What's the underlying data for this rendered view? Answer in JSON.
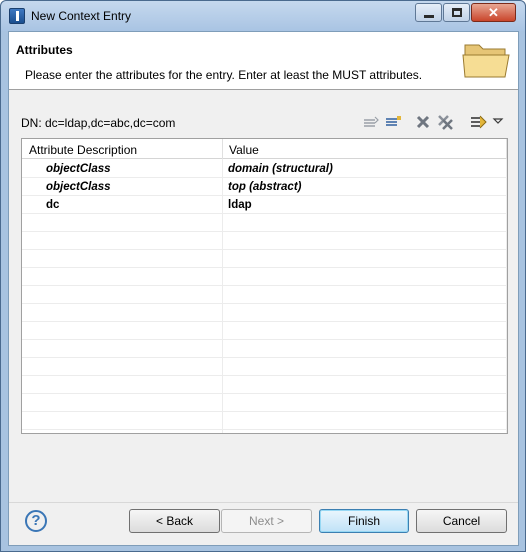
{
  "window": {
    "title": "New Context Entry"
  },
  "banner": {
    "title": "Attributes",
    "description": "Please enter the attributes for the entry. Enter at least the MUST attributes."
  },
  "dn": {
    "label": "DN: dc=ldap,dc=abc,dc=com"
  },
  "toolbar": {
    "icons": [
      "new-attribute-icon",
      "new-value-icon",
      "delete-icon",
      "delete-all-icon",
      "show-operational-icon",
      "view-menu-chevron-icon"
    ]
  },
  "table": {
    "columns": [
      "Attribute Description",
      "Value"
    ],
    "rows": [
      {
        "attribute": "objectClass",
        "value": "domain (structural)",
        "italic": true
      },
      {
        "attribute": "objectClass",
        "value": "top (abstract)",
        "italic": true
      },
      {
        "attribute": "dc",
        "value": "ldap",
        "italic": false
      }
    ],
    "empty_rows": 12
  },
  "buttons": {
    "back": "< Back",
    "next": "Next >",
    "finish": "Finish",
    "cancel": "Cancel"
  },
  "colors": {
    "accent": "#3c7fb1",
    "titlebar": "#a9c4e3"
  }
}
